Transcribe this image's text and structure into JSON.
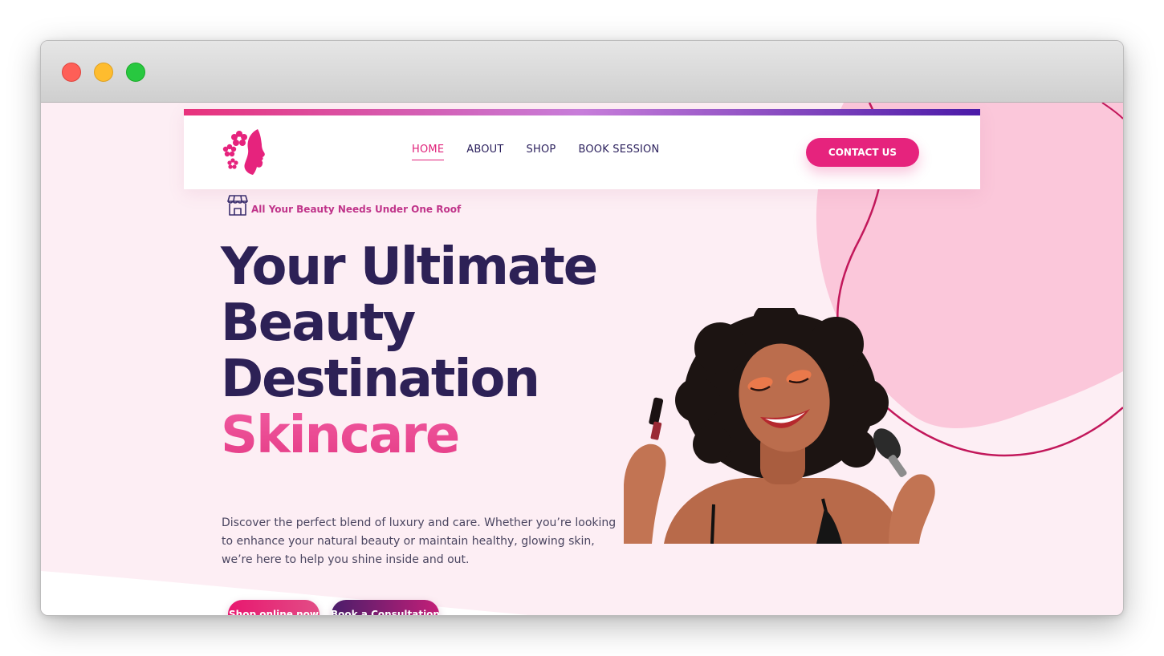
{
  "window": {
    "controls": [
      "close",
      "minimize",
      "zoom"
    ]
  },
  "nav": {
    "logo_icon": "flower-face-logo",
    "links": [
      "HOME",
      "ABOUT",
      "SHOP",
      "BOOK SESSION"
    ],
    "active": "HOME",
    "contact_label": "CONTACT US"
  },
  "hero": {
    "tagline_icon": "storefront-icon",
    "tagline": "All Your Beauty Needs Under One Roof",
    "title_lines": [
      "Your Ultimate",
      "Beauty",
      "Destination"
    ],
    "highlight": "Skincare",
    "description": "Discover the perfect blend of luxury and care. Whether you’re looking to enhance your natural beauty or maintain healthy, glowing skin, we’re here to help you shine inside and out.",
    "primary_cta": "Shop online now",
    "secondary_cta": "Book a Consultation",
    "image_subject": "woman-with-makeup-brushes-photo"
  },
  "colors": {
    "brand_pink": "#e6237d",
    "navy_text": "#2d2156",
    "page_background": "#fdeef4",
    "blob_pink": "#fbc7da",
    "accent_purple": "#4a1aa8"
  }
}
